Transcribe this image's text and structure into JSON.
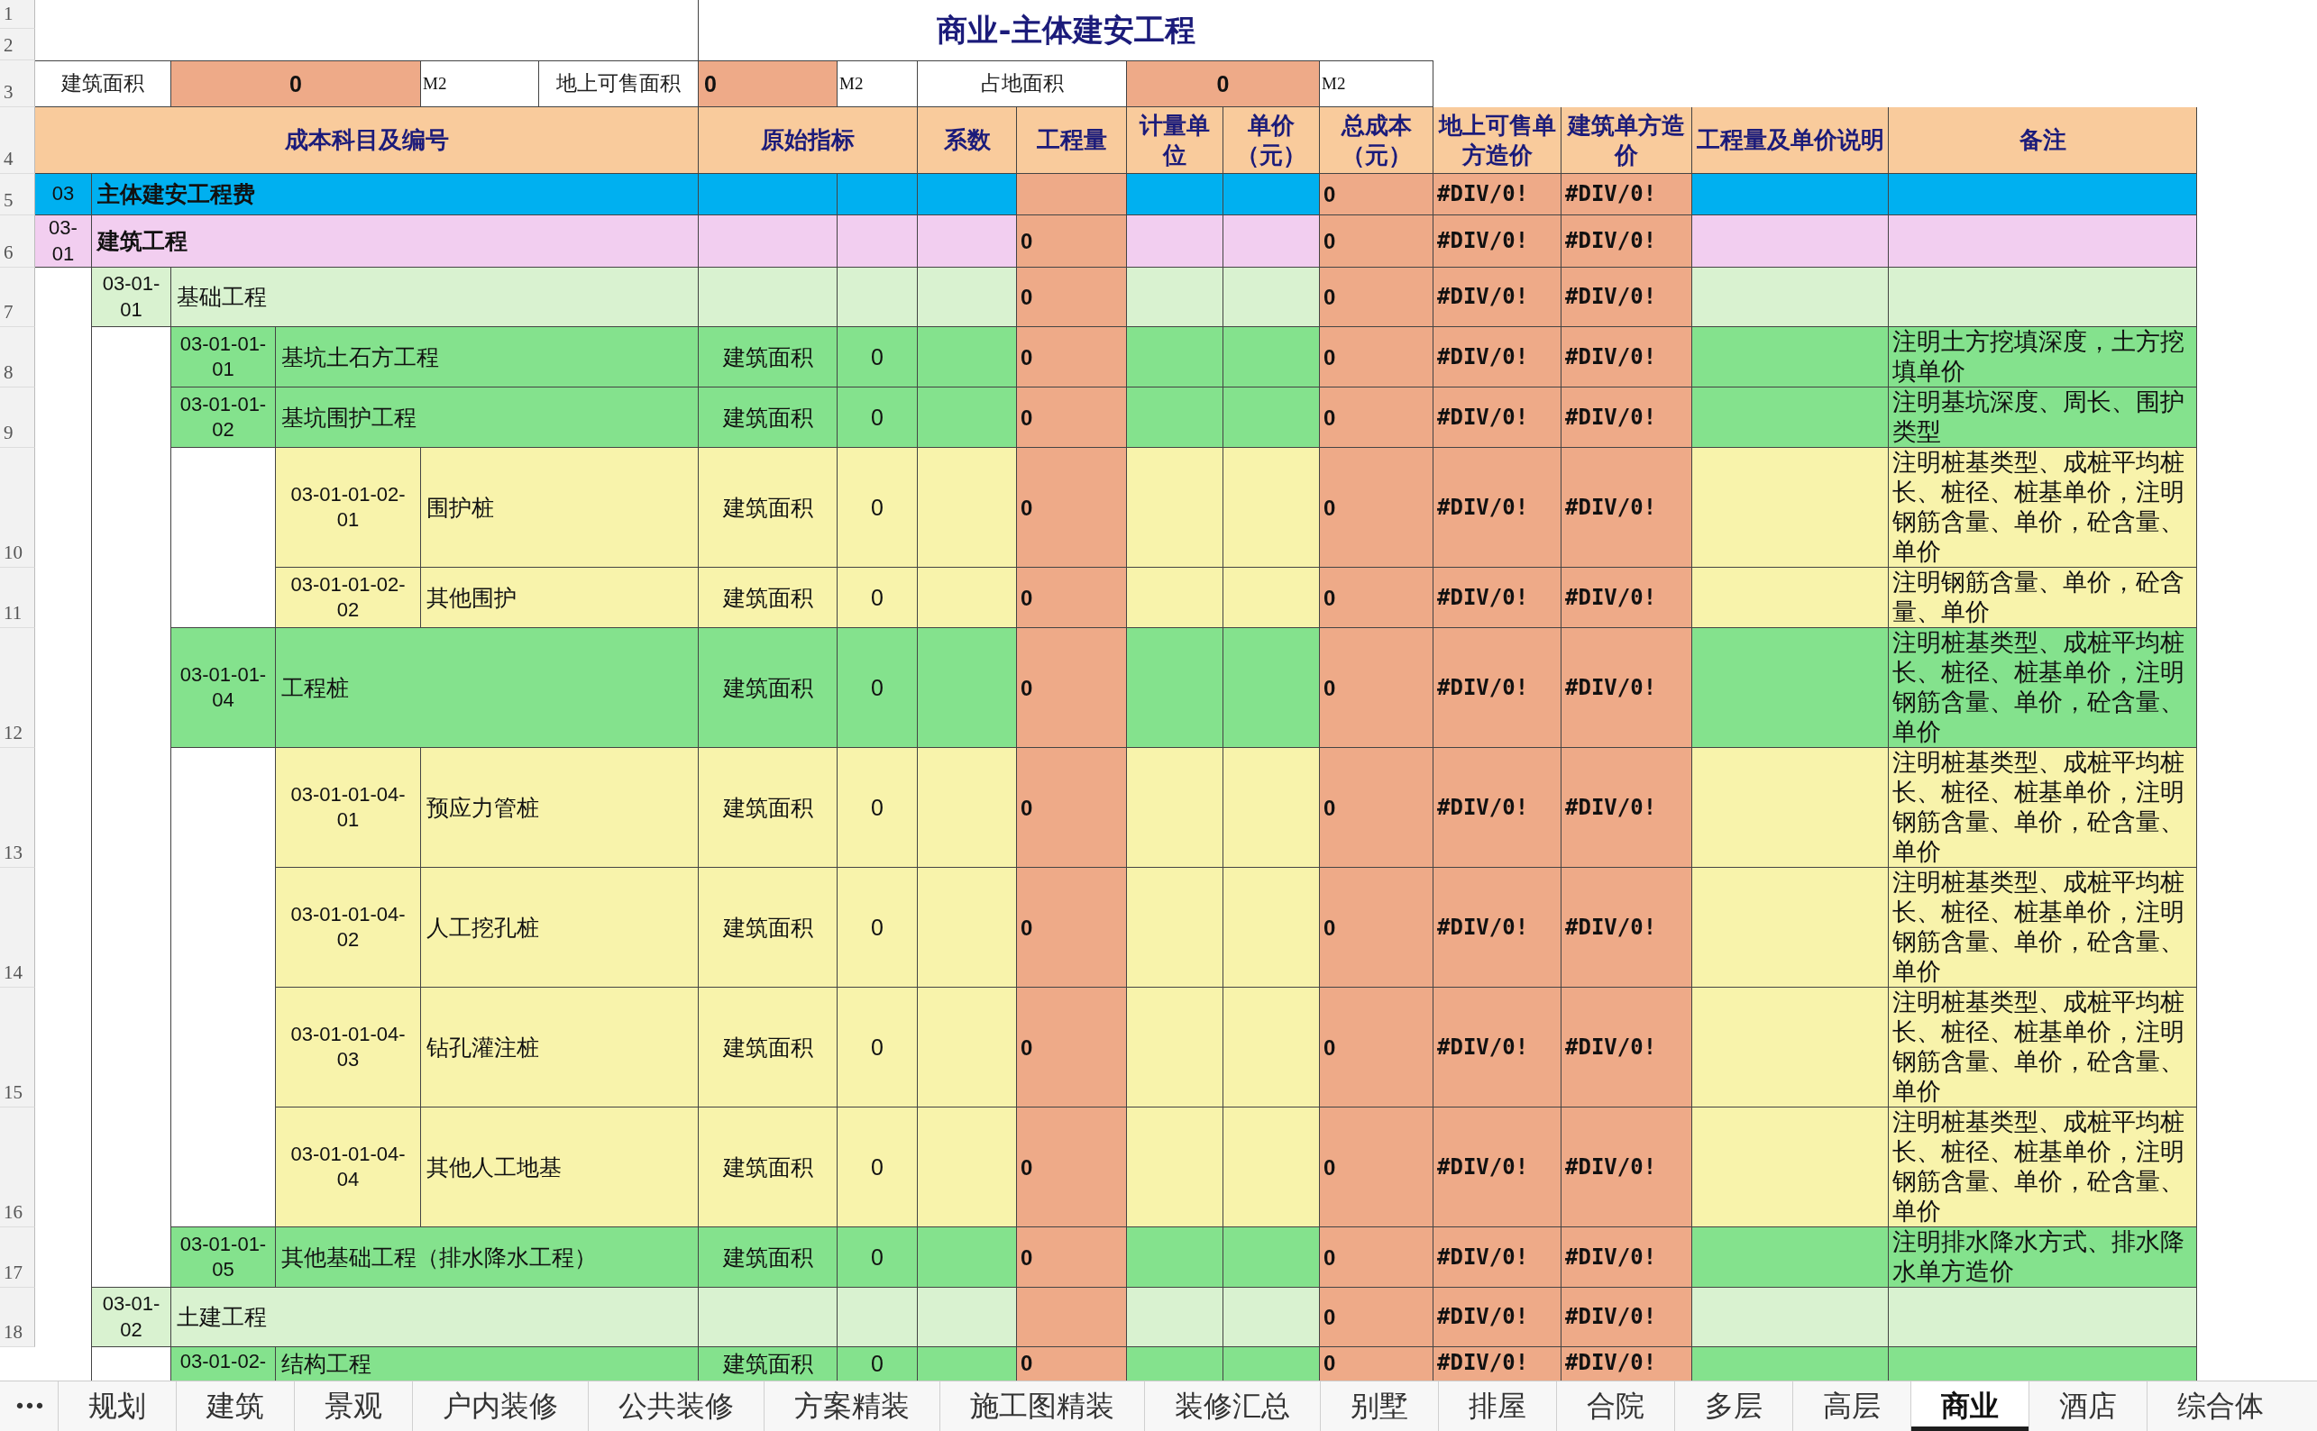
{
  "title": "商业-主体建安工程",
  "row_numbers": [
    "1",
    "2",
    "3",
    "4",
    "5",
    "6",
    "7",
    "8",
    "9",
    "10",
    "11",
    "12",
    "13",
    "14",
    "15",
    "16",
    "17",
    "18"
  ],
  "summary": [
    {
      "label": "建筑面积",
      "value": "0",
      "unit": "M2"
    },
    {
      "label": "地上可售面积",
      "value": "0",
      "unit": "M2"
    },
    {
      "label": "占地面积",
      "value": "0",
      "unit": "M2"
    }
  ],
  "columns": [
    "成本科目及编号",
    "原始指标",
    "系数",
    "工程量",
    "计量单位",
    "单价（元）",
    "总成本（元）",
    "地上可售单方造价",
    "建筑单方造价",
    "工程量及单价说明",
    "备注"
  ],
  "items": [
    {
      "code": "03",
      "name": "主体建安工程费",
      "total_cost": "0",
      "sale_unit_cost": "#DIV/0!",
      "build_unit_cost": "#DIV/0!",
      "children": [
        {
          "code": "03-01",
          "name": "建筑工程",
          "quantity": "0",
          "total_cost": "0",
          "sale_unit_cost": "#DIV/0!",
          "build_unit_cost": "#DIV/0!",
          "children": [
            {
              "code": "03-01-01",
              "name": "基础工程",
              "quantity": "0",
              "total_cost": "0",
              "sale_unit_cost": "#DIV/0!",
              "build_unit_cost": "#DIV/0!",
              "children": [
                {
                  "code": "03-01-01-01",
                  "name": "基坑土石方工程",
                  "indicator": "建筑面积",
                  "indicator_value": "0",
                  "quantity": "0",
                  "total_cost": "0",
                  "sale_unit_cost": "#DIV/0!",
                  "build_unit_cost": "#DIV/0!",
                  "note": "注明土方挖填深度，土方挖填单价"
                },
                {
                  "code": "03-01-01-02",
                  "name": "基坑围护工程",
                  "indicator": "建筑面积",
                  "indicator_value": "0",
                  "quantity": "0",
                  "total_cost": "0",
                  "sale_unit_cost": "#DIV/0!",
                  "build_unit_cost": "#DIV/0!",
                  "note": "注明基坑深度、周长、围护类型",
                  "children": [
                    {
                      "code": "03-01-01-02-01",
                      "name": "围护桩",
                      "indicator": "建筑面积",
                      "indicator_value": "0",
                      "quantity": "0",
                      "total_cost": "0",
                      "sale_unit_cost": "#DIV/0!",
                      "build_unit_cost": "#DIV/0!",
                      "note": "注明桩基类型、成桩平均桩长、桩径、桩基单价，注明钢筋含量、单价，砼含量、单价"
                    },
                    {
                      "code": "03-01-01-02-02",
                      "name": "其他围护",
                      "indicator": "建筑面积",
                      "indicator_value": "0",
                      "quantity": "0",
                      "total_cost": "0",
                      "sale_unit_cost": "#DIV/0!",
                      "build_unit_cost": "#DIV/0!",
                      "note": "注明钢筋含量、单价，砼含量、单价"
                    }
                  ]
                },
                {
                  "code": "03-01-01-04",
                  "name": "工程桩",
                  "indicator": "建筑面积",
                  "indicator_value": "0",
                  "quantity": "0",
                  "total_cost": "0",
                  "sale_unit_cost": "#DIV/0!",
                  "build_unit_cost": "#DIV/0!",
                  "note": "注明桩基类型、成桩平均桩长、桩径、桩基单价，注明钢筋含量、单价，砼含量、单价",
                  "children": [
                    {
                      "code": "03-01-01-04-01",
                      "name": "预应力管桩",
                      "indicator": "建筑面积",
                      "indicator_value": "0",
                      "quantity": "0",
                      "total_cost": "0",
                      "sale_unit_cost": "#DIV/0!",
                      "build_unit_cost": "#DIV/0!",
                      "note": "注明桩基类型、成桩平均桩长、桩径、桩基单价，注明钢筋含量、单价，砼含量、单价"
                    },
                    {
                      "code": "03-01-01-04-02",
                      "name": "人工挖孔桩",
                      "indicator": "建筑面积",
                      "indicator_value": "0",
                      "quantity": "0",
                      "total_cost": "0",
                      "sale_unit_cost": "#DIV/0!",
                      "build_unit_cost": "#DIV/0!",
                      "note": "注明桩基类型、成桩平均桩长、桩径、桩基单价，注明钢筋含量、单价，砼含量、单价"
                    },
                    {
                      "code": "03-01-01-04-03",
                      "name": "钻孔灌注桩",
                      "indicator": "建筑面积",
                      "indicator_value": "0",
                      "quantity": "0",
                      "total_cost": "0",
                      "sale_unit_cost": "#DIV/0!",
                      "build_unit_cost": "#DIV/0!",
                      "note": "注明桩基类型、成桩平均桩长、桩径、桩基单价，注明钢筋含量、单价，砼含量、单价"
                    },
                    {
                      "code": "03-01-01-04-04",
                      "name": "其他人工地基",
                      "indicator": "建筑面积",
                      "indicator_value": "0",
                      "quantity": "0",
                      "total_cost": "0",
                      "sale_unit_cost": "#DIV/0!",
                      "build_unit_cost": "#DIV/0!",
                      "note": "注明桩基类型、成桩平均桩长、桩径、桩基单价，注明钢筋含量、单价，砼含量、单价"
                    }
                  ]
                },
                {
                  "code": "03-01-01-05",
                  "name": "其他基础工程（排水降水工程）",
                  "indicator": "建筑面积",
                  "indicator_value": "0",
                  "quantity": "0",
                  "total_cost": "0",
                  "sale_unit_cost": "#DIV/0!",
                  "build_unit_cost": "#DIV/0!",
                  "note": "注明排水降水方式、排水降水单方造价"
                }
              ]
            },
            {
              "code": "03-01-02",
              "name": "土建工程",
              "total_cost": "0",
              "sale_unit_cost": "#DIV/0!",
              "build_unit_cost": "#DIV/0!",
              "children": [
                {
                  "code": "03-01-02-",
                  "name": "结构工程",
                  "indicator": "建筑面积",
                  "indicator_value": "0",
                  "quantity": "0",
                  "total_cost": "0",
                  "sale_unit_cost": "#DIV/0!",
                  "build_unit_cost": "#DIV/0!"
                }
              ]
            }
          ]
        }
      ]
    }
  ],
  "more_tabs": "•••",
  "sheet_tabs": [
    {
      "label": "规划",
      "selected": false
    },
    {
      "label": "建筑",
      "selected": false
    },
    {
      "label": "景观",
      "selected": false
    },
    {
      "label": "户内装修",
      "selected": false
    },
    {
      "label": "公共装修",
      "selected": false
    },
    {
      "label": "方案精装",
      "selected": false
    },
    {
      "label": "施工图精装",
      "selected": false
    },
    {
      "label": "装修汇总",
      "selected": false
    },
    {
      "label": "别墅",
      "selected": false
    },
    {
      "label": "排屋",
      "selected": false
    },
    {
      "label": "合院",
      "selected": false
    },
    {
      "label": "多层",
      "selected": false
    },
    {
      "label": "高层",
      "selected": false
    },
    {
      "label": "商业",
      "selected": true
    },
    {
      "label": "酒店",
      "selected": false
    },
    {
      "label": "综合体",
      "selected": false
    }
  ]
}
